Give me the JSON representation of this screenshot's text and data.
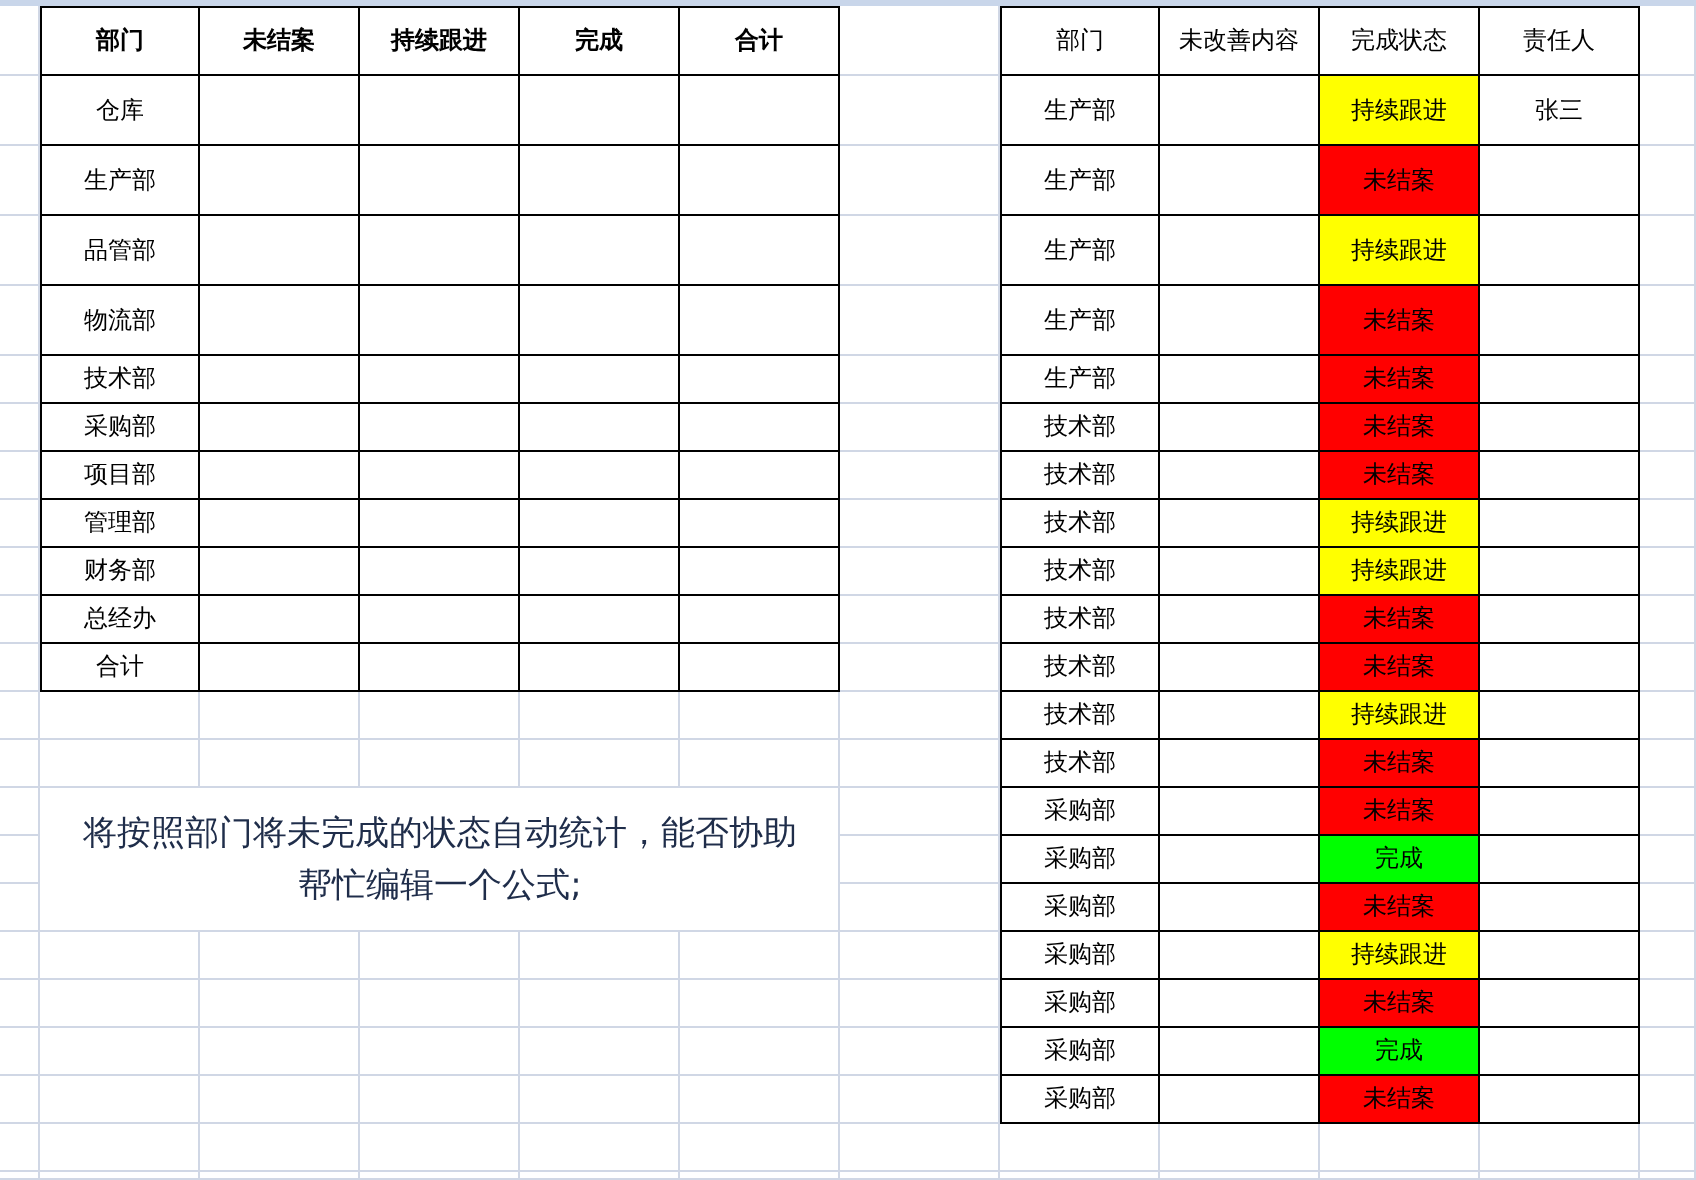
{
  "left_table": {
    "columns": [
      "部门",
      "未结案",
      "持续跟进",
      "完成",
      "合计"
    ],
    "rows": [
      {
        "department": "仓库"
      },
      {
        "department": "生产部"
      },
      {
        "department": "品管部"
      },
      {
        "department": "物流部"
      },
      {
        "department": "技术部"
      },
      {
        "department": "采购部"
      },
      {
        "department": "项目部"
      },
      {
        "department": "管理部"
      },
      {
        "department": "财务部"
      },
      {
        "department": "总经办"
      },
      {
        "department": "合计"
      }
    ]
  },
  "note": "将按照部门将未完成的状态自动统计，能否协助帮忙编辑一个公式;",
  "right_table": {
    "columns": [
      "部门",
      "未改善内容",
      "完成状态",
      "责任人"
    ],
    "rows": [
      {
        "department": "生产部",
        "status": "持续跟进",
        "color": "#ffff00",
        "owner": "张三"
      },
      {
        "department": "生产部",
        "status": "未结案",
        "color": "#ff0000"
      },
      {
        "department": "生产部",
        "status": "持续跟进",
        "color": "#ffff00"
      },
      {
        "department": "生产部",
        "status": "未结案",
        "color": "#ff0000"
      },
      {
        "department": "生产部",
        "status": "未结案",
        "color": "#ff0000"
      },
      {
        "department": "技术部",
        "status": "未结案",
        "color": "#ff0000"
      },
      {
        "department": "技术部",
        "status": "未结案",
        "color": "#ff0000"
      },
      {
        "department": "技术部",
        "status": "持续跟进",
        "color": "#ffff00"
      },
      {
        "department": "技术部",
        "status": "持续跟进",
        "color": "#ffff00"
      },
      {
        "department": "技术部",
        "status": "未结案",
        "color": "#ff0000"
      },
      {
        "department": "技术部",
        "status": "未结案",
        "color": "#ff0000"
      },
      {
        "department": "技术部",
        "status": "持续跟进",
        "color": "#ffff00"
      },
      {
        "department": "技术部",
        "status": "未结案",
        "color": "#ff0000"
      },
      {
        "department": "采购部",
        "status": "未结案",
        "color": "#ff0000"
      },
      {
        "department": "采购部",
        "status": "完成",
        "color": "#00ff00"
      },
      {
        "department": "采购部",
        "status": "未结案",
        "color": "#ff0000"
      },
      {
        "department": "采购部",
        "status": "持续跟进",
        "color": "#ffff00"
      },
      {
        "department": "采购部",
        "status": "未结案",
        "color": "#ff0000"
      },
      {
        "department": "采购部",
        "status": "完成",
        "color": "#00ff00"
      },
      {
        "department": "采购部",
        "status": "未结案",
        "color": "#ff0000"
      }
    ]
  }
}
